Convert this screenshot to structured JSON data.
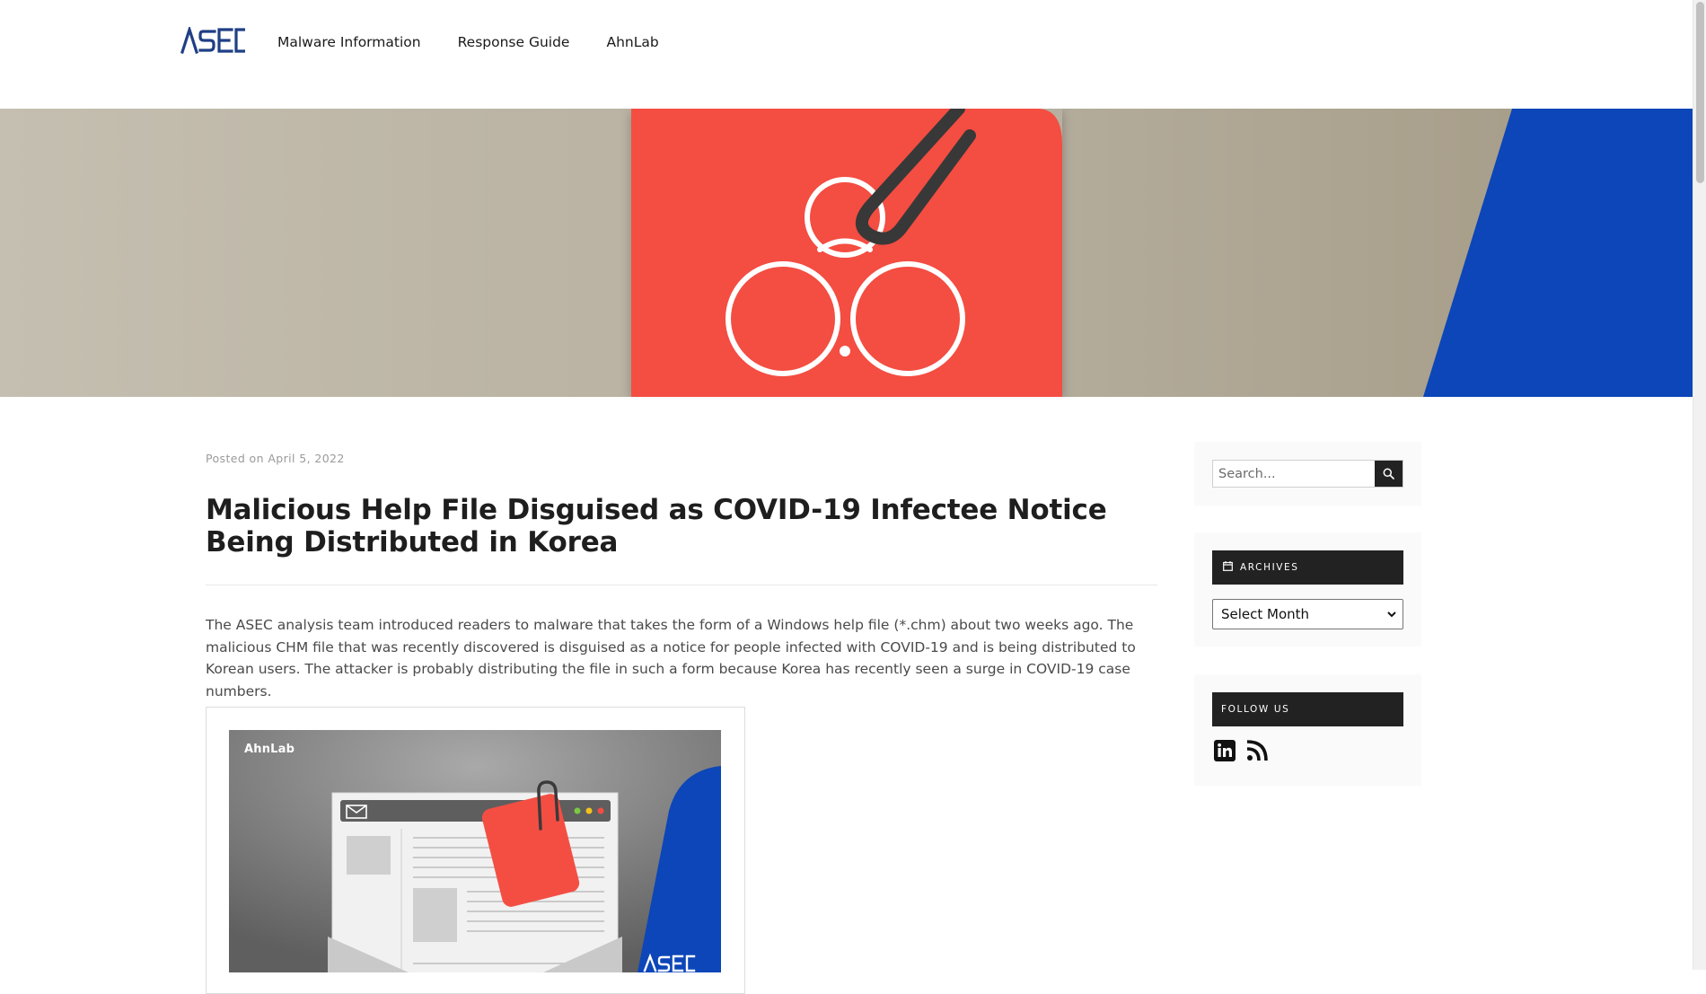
{
  "header": {
    "logo_text": "ASEC",
    "nav": [
      {
        "label": "Malware Information"
      },
      {
        "label": "Response Guide"
      },
      {
        "label": "AhnLab"
      }
    ]
  },
  "hero": {
    "icon": "biohazard-attachment-icon",
    "colors": {
      "card": "#f44e43",
      "accent": "#0c46b8",
      "background": "#bcb5a5"
    }
  },
  "post": {
    "meta_prefix": "Posted on",
    "date": "April 5, 2022",
    "title": "Malicious Help File Disguised as COVID-19 Infectee Notice Being Distributed in Korea",
    "body": "The ASEC analysis team introduced readers to malware that takes the form of a Windows help file (*.chm) about two weeks ago. The malicious CHM file that was recently discovered is disguised as a notice for people infected with COVID-19 and is being distributed to Korean users. The attacker is probably distributing the file in such a form because Korea has recently seen a surge in COVID-19 case numbers.",
    "figure": {
      "brand": "AhnLab",
      "corner_logo": "ASEC"
    }
  },
  "sidebar": {
    "search": {
      "placeholder": "Search...",
      "icon": "search-icon"
    },
    "archives": {
      "heading": "ARCHIVES",
      "icon": "calendar-icon",
      "select_value": "Select Month"
    },
    "follow": {
      "heading": "FOLLOW US",
      "links": [
        {
          "icon": "linkedin-icon"
        },
        {
          "icon": "rss-icon"
        }
      ]
    }
  }
}
